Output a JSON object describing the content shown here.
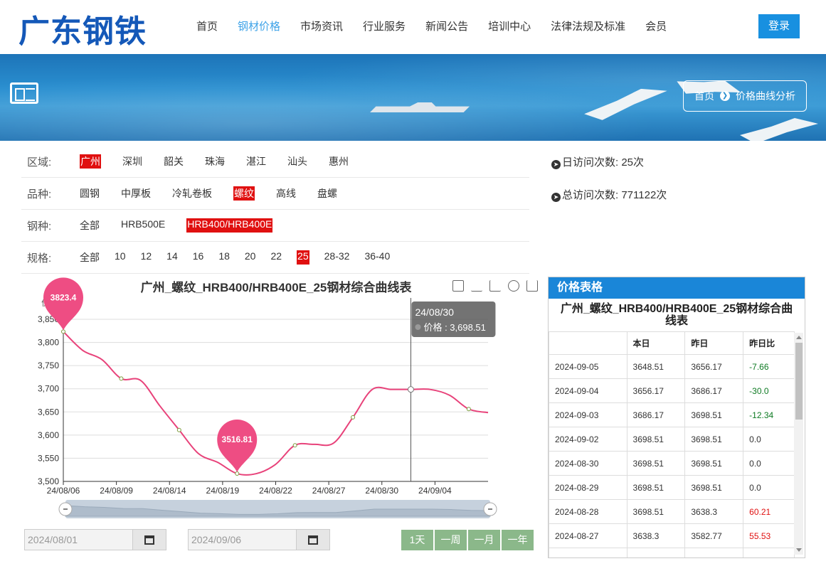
{
  "header": {
    "logo": "广东钢铁",
    "nav": [
      "首页",
      "钢材价格",
      "市场资讯",
      "行业服务",
      "新闻公告",
      "培训中心",
      "法律法规及标准",
      "会员"
    ],
    "active_nav": 1,
    "login_label": "登录"
  },
  "banner": {
    "icon": "newspaper-icon",
    "crumb_home": "首页",
    "crumb_current": "价格曲线分析"
  },
  "filters": {
    "region": {
      "label": "区域:",
      "options": [
        "广州",
        "深圳",
        "韶关",
        "珠海",
        "湛江",
        "汕头",
        "惠州"
      ],
      "selected": 0
    },
    "variety": {
      "label": "品种:",
      "options": [
        "圆钢",
        "中厚板",
        "冷轧卷板",
        "螺纹",
        "高线",
        "盘螺"
      ],
      "selected": 3
    },
    "grade": {
      "label": "钢种:",
      "options": [
        "全部",
        "HRB500E",
        "HRB400/HRB400E"
      ],
      "selected": 2
    },
    "spec": {
      "label": "规格:",
      "options": [
        "全部",
        "10",
        "12",
        "14",
        "16",
        "18",
        "20",
        "22",
        "25",
        "28-32",
        "36-40"
      ],
      "selected": 8
    }
  },
  "stats": {
    "daily_label": "日访问次数:",
    "daily_value": "25次",
    "total_label": "总访问次数:",
    "total_value": "771122次"
  },
  "chart_data": {
    "type": "line",
    "title": "广州_螺纹_HRB400/HRB400E_25钢材综合曲线表",
    "ylabel": "价格(元)",
    "ylim": [
      3500,
      3850
    ],
    "yticks": [
      "3,500",
      "3,550",
      "3,600",
      "3,650",
      "3,700",
      "3,750",
      "3,800",
      "3,850"
    ],
    "x_tick_labels": [
      "24/08/06",
      "24/08/09",
      "24/08/14",
      "24/08/19",
      "24/08/22",
      "24/08/27",
      "24/08/30",
      "24/09/04"
    ],
    "series": [
      {
        "name": "价格",
        "color": "#e8427a",
        "values": [
          3823.4,
          3783,
          3763,
          3722,
          3718,
          3663,
          3611,
          3560,
          3541,
          3516.81,
          3516.81,
          3537,
          3578,
          3580,
          3582.77,
          3638.3,
          3698.51,
          3698.51,
          3698.51,
          3698.51,
          3686.17,
          3656.17,
          3648.51
        ]
      }
    ],
    "max_pin": {
      "value": "3823.4",
      "index": 0
    },
    "min_pin": {
      "value": "3516.81",
      "index": 9
    },
    "tooltip": {
      "date": "24/08/30",
      "label": "价格 : 3,698.51",
      "index": 18
    },
    "grid": true
  },
  "date_range": {
    "start": "2024/08/01",
    "end": "2024/09/06"
  },
  "range_buttons": [
    "1天",
    "一周",
    "一月",
    "一年"
  ],
  "price_table": {
    "heading": "价格表格",
    "title": "广州_螺纹_HRB400/HRB400E_25钢材综合曲线表",
    "columns": [
      "",
      "本日",
      "昨日",
      "昨日比"
    ],
    "rows": [
      [
        "2024-09-05",
        "3648.51",
        "3656.17",
        "-7.66"
      ],
      [
        "2024-09-04",
        "3656.17",
        "3686.17",
        "-30.0"
      ],
      [
        "2024-09-03",
        "3686.17",
        "3698.51",
        "-12.34"
      ],
      [
        "2024-09-02",
        "3698.51",
        "3698.51",
        "0.0"
      ],
      [
        "2024-08-30",
        "3698.51",
        "3698.51",
        "0.0"
      ],
      [
        "2024-08-29",
        "3698.51",
        "3698.51",
        "0.0"
      ],
      [
        "2024-08-28",
        "3698.51",
        "3638.3",
        "60.21"
      ],
      [
        "2024-08-27",
        "3638.3",
        "3582.77",
        "55.53"
      ],
      [
        "",
        "",
        "",
        ""
      ]
    ]
  }
}
